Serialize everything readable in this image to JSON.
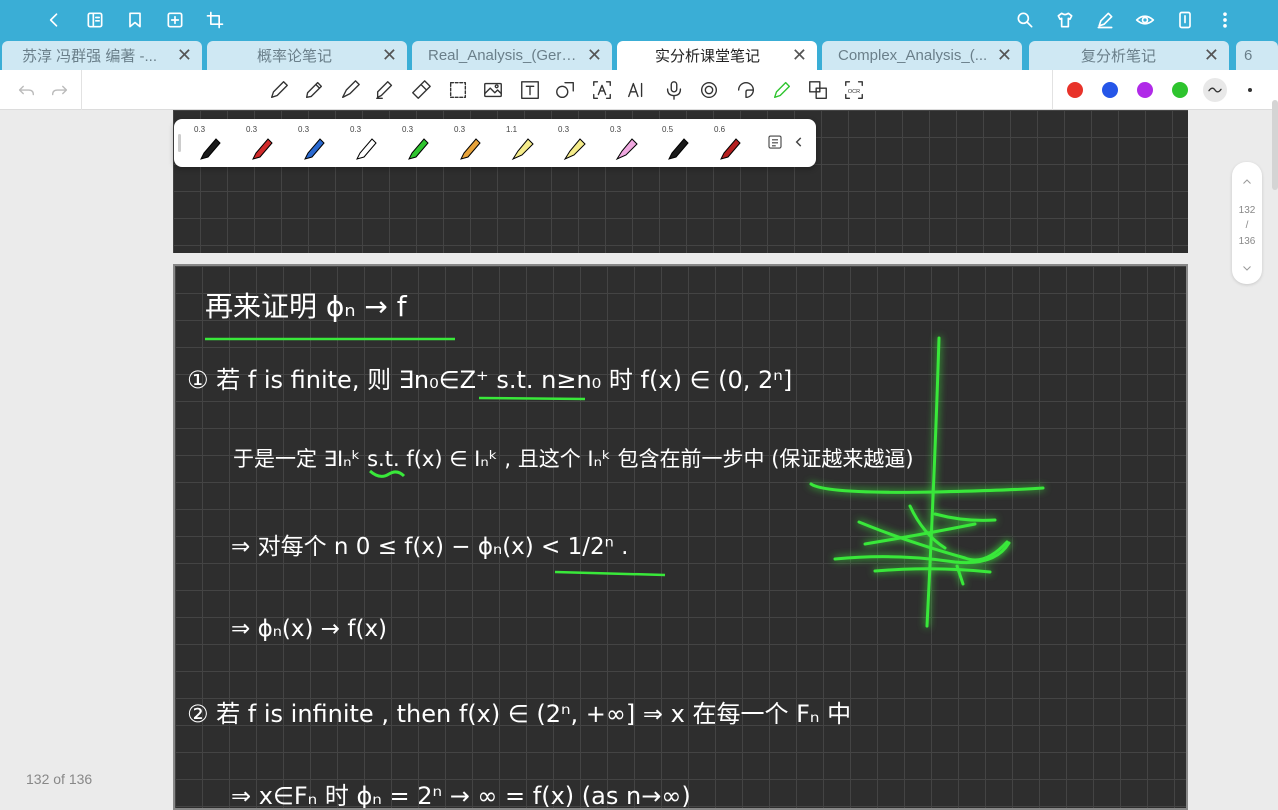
{
  "tabs": [
    {
      "label": "苏淳 冯群强 编著 -..."
    },
    {
      "label": "概率论笔记"
    },
    {
      "label": "Real_Analysis_(Gera..."
    },
    {
      "label": "实分析课堂笔记"
    },
    {
      "label": "Complex_Analysis_(..."
    },
    {
      "label": "复分析笔记"
    },
    {
      "label": "6"
    }
  ],
  "close_glyph": "✕",
  "pens": [
    {
      "width": "0.3",
      "color": "#1a1a1a"
    },
    {
      "width": "0.3",
      "color": "#d12b2b"
    },
    {
      "width": "0.3",
      "color": "#2b6ad1"
    },
    {
      "width": "0.3",
      "color": "#ffffff"
    },
    {
      "width": "0.3",
      "color": "#2ec42e"
    },
    {
      "width": "0.3",
      "color": "#e8a33a"
    },
    {
      "width": "1.1",
      "color": "#f5ec8a"
    },
    {
      "width": "0.3",
      "color": "#f5ec8a"
    },
    {
      "width": "0.3",
      "color": "#f0a8e0"
    },
    {
      "width": "0.5",
      "color": "#1a1a1a"
    },
    {
      "width": "0.6",
      "color": "#b51f1f"
    }
  ],
  "colors": {
    "red": "#e8332a",
    "blue": "#2556e8",
    "purple": "#b02ae8",
    "green": "#2ec42e",
    "accent": "#3aaed6",
    "ink_green": "#39e83a"
  },
  "scroller": {
    "current": "132",
    "sep": "/",
    "total": "136"
  },
  "page_counter": "132 of 136",
  "notes": {
    "title": "再来证明 ϕₙ → f",
    "line1": "① 若 f is finite,   则 ∃n₀∈Z⁺  s.t.   n≥n₀ 时   f(x) ∈ (0, 2ⁿ]",
    "line2": "于是一定 ∃Iₙᵏ  s.t.   f(x) ∈ Iₙᵏ ,  且这个 Iₙᵏ 包含在前一步中 (保证越来越逼)",
    "line3": "⇒ 对每个 n    0 ≤ f(x) − ϕₙ(x) < 1/2ⁿ .",
    "line4": "⇒  ϕₙ(x) → f(x)",
    "line5": "② 若 f is infinite ,  then    f(x) ∈ (2ⁿ, +∞]  ⇒   x 在每一个 Fₙ 中",
    "line6": "⇒ x∈Fₙ 时  ϕₙ = 2ⁿ → ∞ = f(x)     (as n→∞)"
  }
}
